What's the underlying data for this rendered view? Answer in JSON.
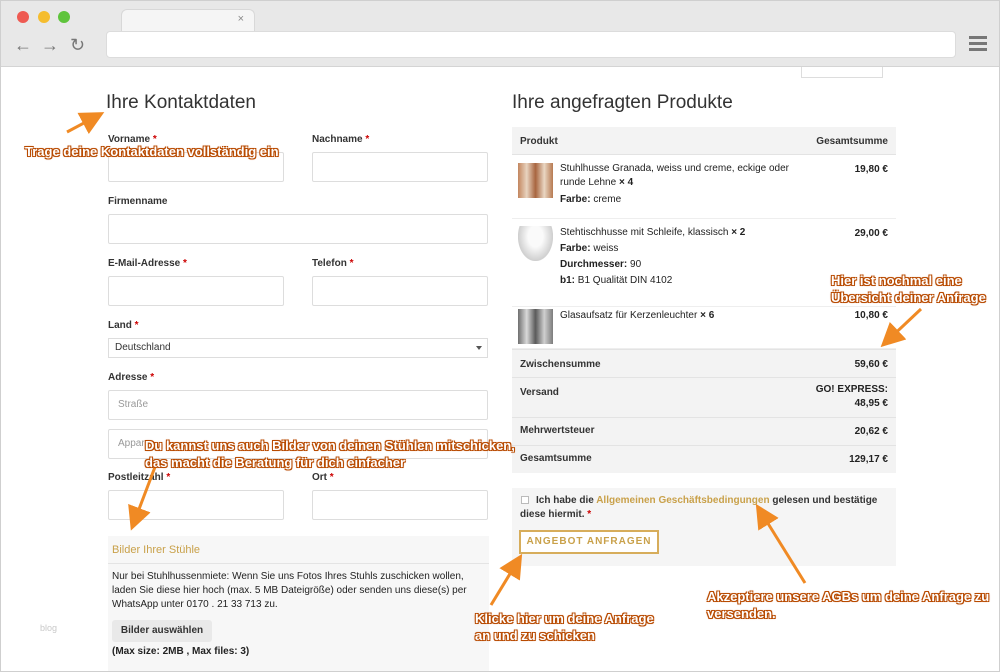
{
  "browser": {
    "tab_close": "×",
    "nav_back": "←",
    "nav_forward": "→",
    "reload": "↻"
  },
  "contact": {
    "heading": "Ihre Kontaktdaten",
    "vorname_label": "Vorname",
    "nachname_label": "Nachname",
    "firma_label": "Firmenname",
    "email_label": "E-Mail-Adresse",
    "telefon_label": "Telefon",
    "land_label": "Land",
    "land_value": "Deutschland",
    "adresse_label": "Adresse",
    "strasse_placeholder": "Straße",
    "appartment_placeholder": "Appar",
    "plz_label": "Postleitzahl",
    "ort_label": "Ort",
    "required_mark": "*"
  },
  "upload": {
    "title": "Bilder Ihrer Stühle",
    "text": "Nur bei Stuhlhussenmiete: Wenn Sie uns Fotos Ihres Stuhls zuschicken wollen, laden Sie diese hier hoch (max. 5 MB Dateigröße) oder senden uns diese(s) per WhatsApp unter 0170 . 21 33 713 zu.",
    "button": "Bilder auswählen",
    "max": "(Max size: 2MB , Max files: 3)"
  },
  "watermark": "blog",
  "products": {
    "heading": "Ihre angefragten Produkte",
    "col_product": "Produkt",
    "col_total": "Gesamtsumme",
    "items": [
      {
        "name": "Stuhlhusse Granada, weiss und creme, eckige oder runde Lehne",
        "qty": "× 4",
        "meta": [
          {
            "k": "Farbe:",
            "v": "creme"
          }
        ],
        "price": "19,80 €",
        "thumb_color": "#b9744f"
      },
      {
        "name": "Stehtischhusse mit Schleife, klassisch",
        "qty": "× 2",
        "meta": [
          {
            "k": "Farbe:",
            "v": "weiss"
          },
          {
            "k": "Durchmesser:",
            "v": "90"
          },
          {
            "k": "b1:",
            "v": "B1 Qualität DIN 4102"
          }
        ],
        "price": "29,00 €",
        "thumb_color": "#dcdcdc"
      },
      {
        "name": "Glasaufsatz für Kerzenleuchter",
        "qty": "× 6",
        "meta": [],
        "price": "10,80 €",
        "thumb_color": "#8a8a8a"
      }
    ],
    "subtotal_label": "Zwischensumme",
    "subtotal_value": "59,60 €",
    "shipping_label": "Versand",
    "shipping_value_1": "GO! EXPRESS:",
    "shipping_value_2": "48,95 €",
    "tax_label": "Mehrwertsteuer",
    "tax_value": "20,62 €",
    "total_label": "Gesamtsumme",
    "total_value": "129,17 €"
  },
  "terms": {
    "text_before": "Ich habe die ",
    "link": "Allgemeinen Geschäftsbedingungen",
    "text_after": " gelesen und bestätige diese hiermit.",
    "required_mark": "*",
    "submit": "ANGEBOT ANFRAGEN"
  },
  "annotations": {
    "contact_1": "Trage deine Kontaktdaten vollständig ein",
    "photos_1": "Du kannst uns auch Bilder von deinen Stühlen mitschicken,",
    "photos_2": "das macht die Beratung für dich einfacher",
    "overview_1": "Hier ist nochmal eine",
    "overview_2": "Übersicht deiner Anfrage",
    "submit_1": "Klicke hier um deine Anfrage",
    "submit_2": "an und zu schicken",
    "agb_1": "Akzeptiere unsere AGBs um deine Anfrage zu",
    "agb_2": "versenden."
  },
  "colors": {
    "accent": "#c9a14a",
    "annotation": "#f08a24",
    "required": "#cc0000"
  }
}
